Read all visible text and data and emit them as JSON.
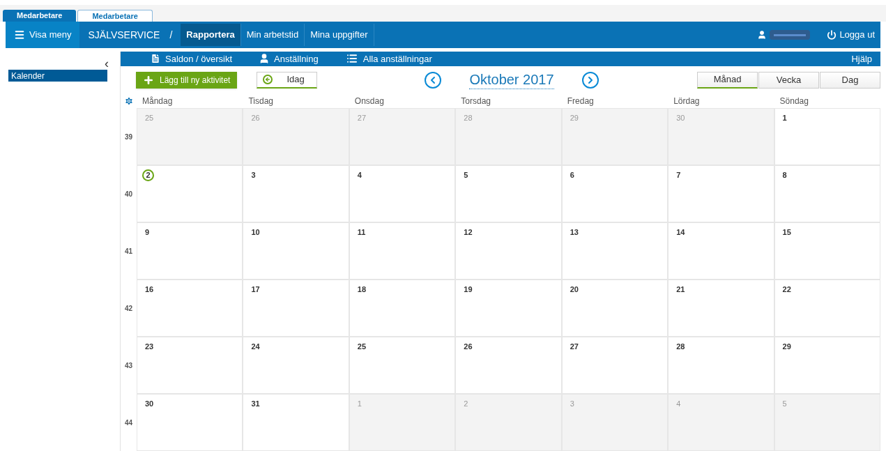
{
  "app_tabs": [
    {
      "label": "Medarbetare",
      "selected": true
    },
    {
      "label": "Medarbetare",
      "selected": false
    }
  ],
  "header": {
    "menu_button": "Visa meny",
    "section": "SJÄLVSERVICE",
    "separator": "/",
    "nav": [
      {
        "label": "Rapportera",
        "selected": true
      },
      {
        "label": "Min arbetstid",
        "selected": false
      },
      {
        "label": "Mina uppgifter",
        "selected": false
      }
    ],
    "logout": "Logga ut"
  },
  "sidebar": {
    "collapse": "‹",
    "items": [
      {
        "label": "Kalender",
        "selected": true
      }
    ]
  },
  "subnav": {
    "links": [
      {
        "label": "Saldon / översikt",
        "kind": "document"
      },
      {
        "label": "Anställning",
        "kind": "person"
      },
      {
        "label": "Alla anställningar",
        "kind": "list"
      }
    ],
    "help": "Hjälp"
  },
  "toolbar": {
    "add_button": "Lägg till ny aktivitet",
    "today_button": "Idag",
    "month_title": "Oktober 2017",
    "views": [
      {
        "label": "Månad",
        "selected": true
      },
      {
        "label": "Vecka",
        "selected": false
      },
      {
        "label": "Dag",
        "selected": false
      }
    ]
  },
  "calendar": {
    "weekdays": [
      "Måndag",
      "Tisdag",
      "Onsdag",
      "Torsdag",
      "Fredag",
      "Lördag",
      "Söndag"
    ],
    "weeks": [
      {
        "number": "39",
        "days": [
          {
            "label": "25",
            "outside": true,
            "today": false
          },
          {
            "label": "26",
            "outside": true,
            "today": false
          },
          {
            "label": "27",
            "outside": true,
            "today": false
          },
          {
            "label": "28",
            "outside": true,
            "today": false
          },
          {
            "label": "29",
            "outside": true,
            "today": false
          },
          {
            "label": "30",
            "outside": true,
            "today": false
          },
          {
            "label": "1",
            "outside": false,
            "today": false
          }
        ]
      },
      {
        "number": "40",
        "days": [
          {
            "label": "2",
            "outside": false,
            "today": true
          },
          {
            "label": "3",
            "outside": false,
            "today": false
          },
          {
            "label": "4",
            "outside": false,
            "today": false
          },
          {
            "label": "5",
            "outside": false,
            "today": false
          },
          {
            "label": "6",
            "outside": false,
            "today": false
          },
          {
            "label": "7",
            "outside": false,
            "today": false
          },
          {
            "label": "8",
            "outside": false,
            "today": false
          }
        ]
      },
      {
        "number": "41",
        "days": [
          {
            "label": "9",
            "outside": false,
            "today": false
          },
          {
            "label": "10",
            "outside": false,
            "today": false
          },
          {
            "label": "11",
            "outside": false,
            "today": false
          },
          {
            "label": "12",
            "outside": false,
            "today": false
          },
          {
            "label": "13",
            "outside": false,
            "today": false
          },
          {
            "label": "14",
            "outside": false,
            "today": false
          },
          {
            "label": "15",
            "outside": false,
            "today": false
          }
        ]
      },
      {
        "number": "42",
        "days": [
          {
            "label": "16",
            "outside": false,
            "today": false
          },
          {
            "label": "17",
            "outside": false,
            "today": false
          },
          {
            "label": "18",
            "outside": false,
            "today": false
          },
          {
            "label": "19",
            "outside": false,
            "today": false
          },
          {
            "label": "20",
            "outside": false,
            "today": false
          },
          {
            "label": "21",
            "outside": false,
            "today": false
          },
          {
            "label": "22",
            "outside": false,
            "today": false
          }
        ]
      },
      {
        "number": "43",
        "days": [
          {
            "label": "23",
            "outside": false,
            "today": false
          },
          {
            "label": "24",
            "outside": false,
            "today": false
          },
          {
            "label": "25",
            "outside": false,
            "today": false
          },
          {
            "label": "26",
            "outside": false,
            "today": false
          },
          {
            "label": "27",
            "outside": false,
            "today": false
          },
          {
            "label": "28",
            "outside": false,
            "today": false
          },
          {
            "label": "29",
            "outside": false,
            "today": false
          }
        ]
      },
      {
        "number": "44",
        "days": [
          {
            "label": "30",
            "outside": false,
            "today": false
          },
          {
            "label": "31",
            "outside": false,
            "today": false
          },
          {
            "label": "1",
            "outside": true,
            "today": false
          },
          {
            "label": "2",
            "outside": true,
            "today": false
          },
          {
            "label": "3",
            "outside": true,
            "today": false
          },
          {
            "label": "4",
            "outside": true,
            "today": false
          },
          {
            "label": "5",
            "outside": true,
            "today": false
          }
        ]
      }
    ]
  }
}
